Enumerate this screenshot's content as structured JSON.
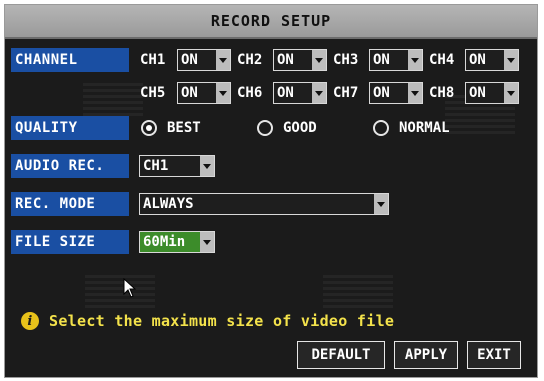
{
  "title": "RECORD SETUP",
  "channel": {
    "label": "CHANNEL",
    "items": [
      {
        "name": "CH1",
        "value": "ON"
      },
      {
        "name": "CH2",
        "value": "ON"
      },
      {
        "name": "CH3",
        "value": "ON"
      },
      {
        "name": "CH4",
        "value": "ON"
      },
      {
        "name": "CH5",
        "value": "ON"
      },
      {
        "name": "CH6",
        "value": "ON"
      },
      {
        "name": "CH7",
        "value": "ON"
      },
      {
        "name": "CH8",
        "value": "ON"
      }
    ]
  },
  "quality": {
    "label": "QUALITY",
    "options": [
      "BEST",
      "GOOD",
      "NORMAL"
    ],
    "selected": "BEST"
  },
  "audio_rec": {
    "label": "AUDIO REC.",
    "value": "CH1"
  },
  "rec_mode": {
    "label": "REC. MODE",
    "value": "ALWAYS"
  },
  "file_size": {
    "label": "FILE SIZE",
    "value": "60Min"
  },
  "tip": {
    "icon": "info-icon",
    "text": "Select the maximum size of video file"
  },
  "buttons": {
    "default": "DEFAULT",
    "apply": "APPLY",
    "exit": "EXIT"
  },
  "colors": {
    "label_bg": "#1a4fa3",
    "tip_text": "#f3e24b",
    "file_size_bg": "#3c8c2a"
  }
}
